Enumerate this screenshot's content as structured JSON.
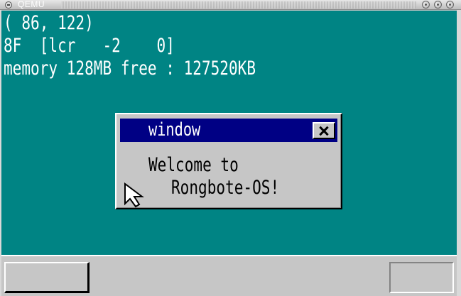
{
  "host": {
    "title": "QEMU"
  },
  "screen": {
    "mouse_coords": "( 86, 122)",
    "key_status": "8F  [lcr   -2    0]",
    "memory_info": "memory 128MB free : 127520KB",
    "background_color": "#008484",
    "text_color": "#ffffff"
  },
  "window": {
    "title": "window",
    "message_line1": "Welcome to",
    "message_line2": "Rongbote-OS!",
    "titlebar_color": "#000084",
    "close_icon": "close-icon"
  },
  "cursor": {
    "icon": "mouse-pointer-icon"
  },
  "taskbar": {
    "background_color": "#c6c6c6"
  }
}
